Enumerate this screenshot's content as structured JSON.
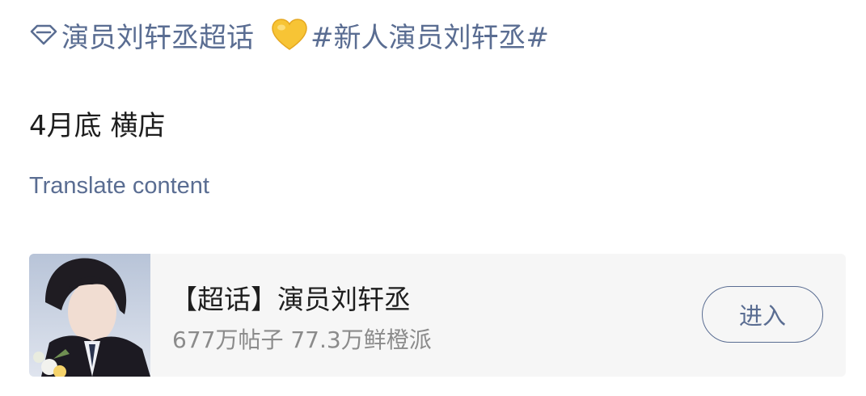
{
  "post": {
    "supertopic_link": "演员刘轩丞超话",
    "hashtag": "#新人演员刘轩丞#",
    "body": "4月底 横店",
    "translate_label": "Translate content"
  },
  "card": {
    "title": "【超话】演员刘轩丞",
    "stats": "677万帖子 77.3万鲜橙派",
    "enter_label": "进入"
  },
  "icons": {
    "supertopic": "diamond-icon",
    "emoji": "yellow-heart-emoji"
  },
  "colors": {
    "link": "#5a6d92",
    "text": "#1e1e1e",
    "secondary": "#8b8b8b",
    "card_bg": "#f6f6f6",
    "heart": "#f7c435"
  }
}
